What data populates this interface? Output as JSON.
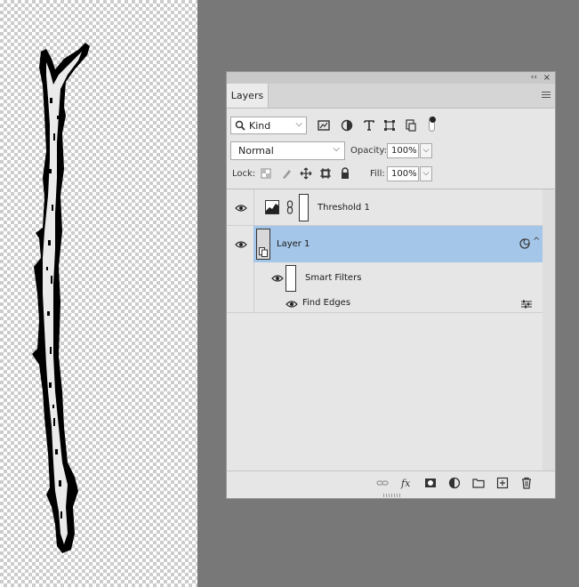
{
  "panel": {
    "collapse_label": "‹‹",
    "close_label": "×",
    "tab": "Layers",
    "filter": {
      "kind": "Kind"
    },
    "blend_mode": "Normal",
    "opacity_label": "Opacity:",
    "opacity_value": "100%",
    "lock_label": "Lock:",
    "fill_label": "Fill:",
    "fill_value": "100%"
  },
  "layers": [
    {
      "name": "Threshold 1",
      "visible": true,
      "kind": "adjustment"
    },
    {
      "name": "Layer 1",
      "visible": true,
      "kind": "smart-object",
      "selected": true
    },
    {
      "name": "Smart Filters",
      "visible": true,
      "kind": "smart-filter-group"
    },
    {
      "name": "Find Edges",
      "visible": true,
      "kind": "filter"
    }
  ],
  "colors": {
    "canvas_bg": "#787878",
    "panel_bg": "#e6e6e6",
    "selection": "#a4c6e8"
  }
}
